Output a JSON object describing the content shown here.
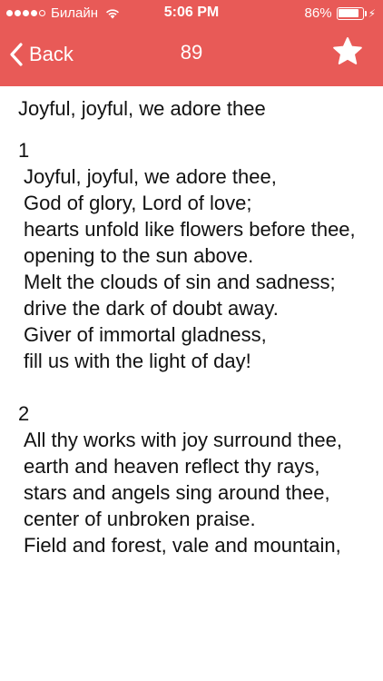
{
  "status_bar": {
    "carrier": "Билайн",
    "time": "5:06 PM",
    "battery_percent": "86%",
    "battery_level": 0.86,
    "signal_bars": 4
  },
  "nav": {
    "back_label": "Back",
    "title": "89",
    "favorite_icon": "star-icon"
  },
  "colors": {
    "header_bg": "#e85a57",
    "header_text": "#ffffff",
    "body_text": "#111111"
  },
  "hymn": {
    "title": "Joyful, joyful, we adore thee",
    "verses": [
      {
        "number": "1",
        "lines": [
          "Joyful, joyful, we adore thee,",
          "God of glory, Lord of love;",
          "hearts unfold like flowers before thee,",
          "opening to the sun above.",
          "Melt the clouds of sin and sadness;",
          "drive the dark of doubt away.",
          "Giver of immortal gladness,",
          "fill us with the light of day!"
        ]
      },
      {
        "number": "2",
        "lines": [
          "All thy works with joy surround thee,",
          "earth and heaven reflect thy rays,",
          "stars and angels sing around thee,",
          "center of unbroken praise.",
          "Field and forest, vale and mountain,"
        ]
      }
    ]
  }
}
